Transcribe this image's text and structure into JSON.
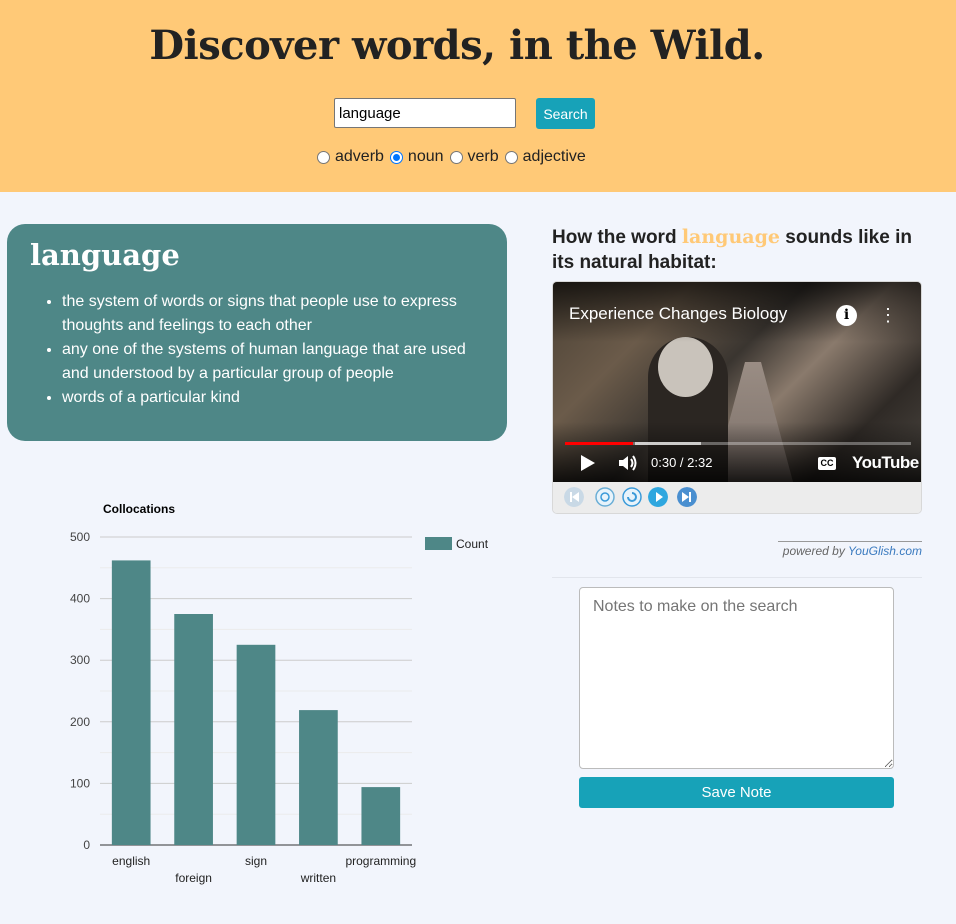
{
  "header": {
    "title": "Discover words, in the Wild.",
    "search_value": "language",
    "search_button": "Search",
    "pos_options": [
      {
        "label": "adverb",
        "checked": false
      },
      {
        "label": "noun",
        "checked": true
      },
      {
        "label": "verb",
        "checked": false
      },
      {
        "label": "adjective",
        "checked": false
      }
    ]
  },
  "definition": {
    "word": "language",
    "senses": [
      "the system of words or signs that people use to express thoughts and feelings to each other",
      "any one of the systems of human language that are used and understood by a particular group of people",
      "words of a particular kind"
    ]
  },
  "video": {
    "heading_prefix": "How the word",
    "heading_word": "language",
    "heading_suffix": "sounds like in its natural habitat:",
    "title": "Experience Changes Biology",
    "time": "0:30 / 2:32",
    "progress": 0.197,
    "cc_label": "CC",
    "logo": "YouTube",
    "powered_prefix": "powered by",
    "powered_link": "YouGlish.com"
  },
  "notes": {
    "placeholder": "Notes to make on the search",
    "save_label": "Save Note"
  },
  "colors": {
    "accent": "#ffc977",
    "teal": "#4e8787",
    "button": "#17a2b8"
  },
  "chart_data": {
    "type": "bar",
    "title": "Collocations",
    "categories": [
      "english",
      "foreign",
      "sign",
      "written",
      "programming"
    ],
    "series": [
      {
        "name": "Count",
        "values": [
          462,
          375,
          325,
          219,
          94
        ]
      }
    ],
    "ylim": [
      0,
      500
    ],
    "yticks": [
      0,
      100,
      200,
      300,
      400,
      500
    ],
    "legend": "right",
    "grid": true
  }
}
